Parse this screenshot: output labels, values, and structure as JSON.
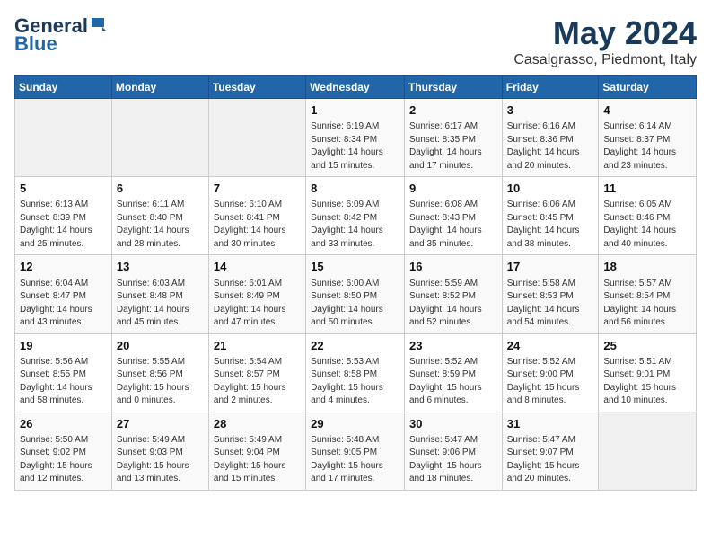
{
  "header": {
    "logo_line1": "General",
    "logo_line2": "Blue",
    "month": "May 2024",
    "location": "Casalgrasso, Piedmont, Italy"
  },
  "days_of_week": [
    "Sunday",
    "Monday",
    "Tuesday",
    "Wednesday",
    "Thursday",
    "Friday",
    "Saturday"
  ],
  "weeks": [
    [
      {
        "day": "",
        "content": ""
      },
      {
        "day": "",
        "content": ""
      },
      {
        "day": "",
        "content": ""
      },
      {
        "day": "1",
        "content": "Sunrise: 6:19 AM\nSunset: 8:34 PM\nDaylight: 14 hours and 15 minutes."
      },
      {
        "day": "2",
        "content": "Sunrise: 6:17 AM\nSunset: 8:35 PM\nDaylight: 14 hours and 17 minutes."
      },
      {
        "day": "3",
        "content": "Sunrise: 6:16 AM\nSunset: 8:36 PM\nDaylight: 14 hours and 20 minutes."
      },
      {
        "day": "4",
        "content": "Sunrise: 6:14 AM\nSunset: 8:37 PM\nDaylight: 14 hours and 23 minutes."
      }
    ],
    [
      {
        "day": "5",
        "content": "Sunrise: 6:13 AM\nSunset: 8:39 PM\nDaylight: 14 hours and 25 minutes."
      },
      {
        "day": "6",
        "content": "Sunrise: 6:11 AM\nSunset: 8:40 PM\nDaylight: 14 hours and 28 minutes."
      },
      {
        "day": "7",
        "content": "Sunrise: 6:10 AM\nSunset: 8:41 PM\nDaylight: 14 hours and 30 minutes."
      },
      {
        "day": "8",
        "content": "Sunrise: 6:09 AM\nSunset: 8:42 PM\nDaylight: 14 hours and 33 minutes."
      },
      {
        "day": "9",
        "content": "Sunrise: 6:08 AM\nSunset: 8:43 PM\nDaylight: 14 hours and 35 minutes."
      },
      {
        "day": "10",
        "content": "Sunrise: 6:06 AM\nSunset: 8:45 PM\nDaylight: 14 hours and 38 minutes."
      },
      {
        "day": "11",
        "content": "Sunrise: 6:05 AM\nSunset: 8:46 PM\nDaylight: 14 hours and 40 minutes."
      }
    ],
    [
      {
        "day": "12",
        "content": "Sunrise: 6:04 AM\nSunset: 8:47 PM\nDaylight: 14 hours and 43 minutes."
      },
      {
        "day": "13",
        "content": "Sunrise: 6:03 AM\nSunset: 8:48 PM\nDaylight: 14 hours and 45 minutes."
      },
      {
        "day": "14",
        "content": "Sunrise: 6:01 AM\nSunset: 8:49 PM\nDaylight: 14 hours and 47 minutes."
      },
      {
        "day": "15",
        "content": "Sunrise: 6:00 AM\nSunset: 8:50 PM\nDaylight: 14 hours and 50 minutes."
      },
      {
        "day": "16",
        "content": "Sunrise: 5:59 AM\nSunset: 8:52 PM\nDaylight: 14 hours and 52 minutes."
      },
      {
        "day": "17",
        "content": "Sunrise: 5:58 AM\nSunset: 8:53 PM\nDaylight: 14 hours and 54 minutes."
      },
      {
        "day": "18",
        "content": "Sunrise: 5:57 AM\nSunset: 8:54 PM\nDaylight: 14 hours and 56 minutes."
      }
    ],
    [
      {
        "day": "19",
        "content": "Sunrise: 5:56 AM\nSunset: 8:55 PM\nDaylight: 14 hours and 58 minutes."
      },
      {
        "day": "20",
        "content": "Sunrise: 5:55 AM\nSunset: 8:56 PM\nDaylight: 15 hours and 0 minutes."
      },
      {
        "day": "21",
        "content": "Sunrise: 5:54 AM\nSunset: 8:57 PM\nDaylight: 15 hours and 2 minutes."
      },
      {
        "day": "22",
        "content": "Sunrise: 5:53 AM\nSunset: 8:58 PM\nDaylight: 15 hours and 4 minutes."
      },
      {
        "day": "23",
        "content": "Sunrise: 5:52 AM\nSunset: 8:59 PM\nDaylight: 15 hours and 6 minutes."
      },
      {
        "day": "24",
        "content": "Sunrise: 5:52 AM\nSunset: 9:00 PM\nDaylight: 15 hours and 8 minutes."
      },
      {
        "day": "25",
        "content": "Sunrise: 5:51 AM\nSunset: 9:01 PM\nDaylight: 15 hours and 10 minutes."
      }
    ],
    [
      {
        "day": "26",
        "content": "Sunrise: 5:50 AM\nSunset: 9:02 PM\nDaylight: 15 hours and 12 minutes."
      },
      {
        "day": "27",
        "content": "Sunrise: 5:49 AM\nSunset: 9:03 PM\nDaylight: 15 hours and 13 minutes."
      },
      {
        "day": "28",
        "content": "Sunrise: 5:49 AM\nSunset: 9:04 PM\nDaylight: 15 hours and 15 minutes."
      },
      {
        "day": "29",
        "content": "Sunrise: 5:48 AM\nSunset: 9:05 PM\nDaylight: 15 hours and 17 minutes."
      },
      {
        "day": "30",
        "content": "Sunrise: 5:47 AM\nSunset: 9:06 PM\nDaylight: 15 hours and 18 minutes."
      },
      {
        "day": "31",
        "content": "Sunrise: 5:47 AM\nSunset: 9:07 PM\nDaylight: 15 hours and 20 minutes."
      },
      {
        "day": "",
        "content": ""
      }
    ]
  ]
}
